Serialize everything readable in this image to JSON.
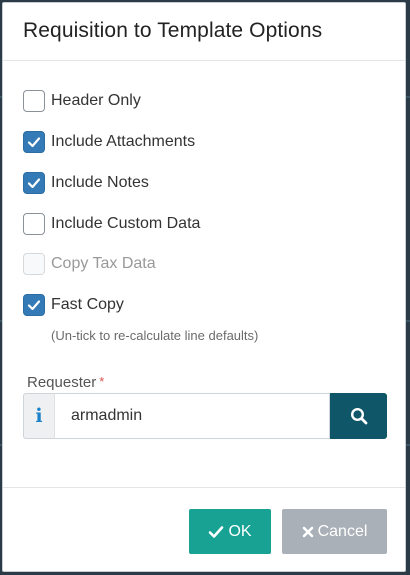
{
  "dialog": {
    "title": "Requisition to Template Options"
  },
  "options": [
    {
      "label": "Header Only",
      "checked": false,
      "disabled": false
    },
    {
      "label": "Include Attachments",
      "checked": true,
      "disabled": false
    },
    {
      "label": "Include Notes",
      "checked": true,
      "disabled": false
    },
    {
      "label": "Include Custom Data",
      "checked": false,
      "disabled": false
    },
    {
      "label": "Copy Tax Data",
      "checked": false,
      "disabled": true
    },
    {
      "label": "Fast Copy",
      "checked": true,
      "disabled": false
    }
  ],
  "fast_copy_hint": "(Un-tick to re-calculate line defaults)",
  "requester": {
    "label": "Requester",
    "required_marker": "*",
    "info_glyph": "i",
    "value": "armadmin"
  },
  "footer": {
    "ok_label": "OK",
    "cancel_label": "Cancel"
  },
  "colors": {
    "checkbox_checked": "#337ab7",
    "search_button": "#0f5668",
    "ok_button": "#17a293",
    "cancel_button": "#a9b0b7",
    "required_star": "#d9534f",
    "info_icon": "#1d82c9"
  },
  "icons": {
    "checkbox_check": "check-icon",
    "requester_info": "info-icon",
    "requester_search": "search-icon",
    "ok": "check-icon",
    "cancel": "close-icon"
  }
}
